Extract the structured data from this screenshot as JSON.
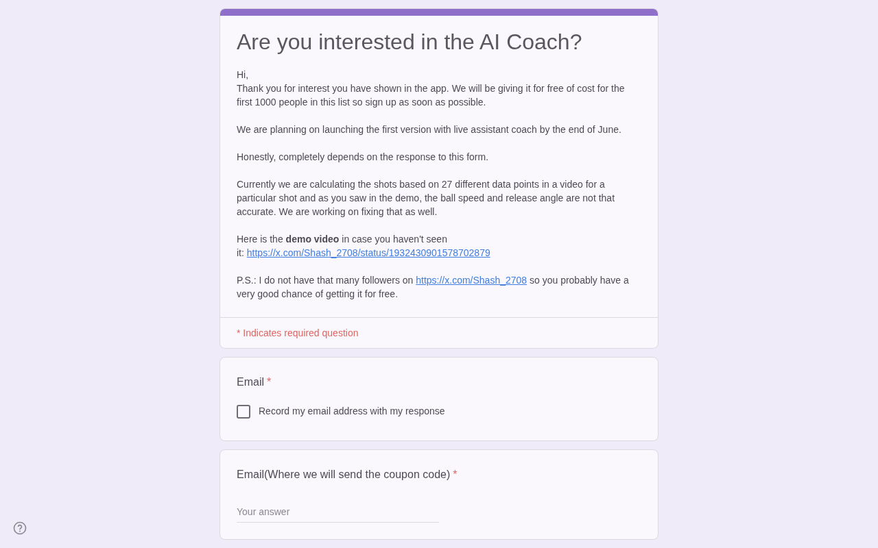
{
  "form": {
    "title": "Are you interested in the AI Coach?",
    "description": [
      {
        "parts": [
          {
            "kind": "text",
            "text": "Hi,"
          },
          {
            "kind": "break"
          },
          {
            "kind": "text",
            "text": "Thank you for interest you have shown in the app. We will be giving it for free of cost for the first 1000 people in this list so sign up as soon as possible."
          }
        ]
      },
      {
        "parts": [
          {
            "kind": "text",
            "text": "We are planning on launching the first version with live assistant coach by the end of June."
          }
        ]
      },
      {
        "parts": [
          {
            "kind": "text",
            "text": "Honestly, completely depends on the response to this form."
          }
        ]
      },
      {
        "parts": [
          {
            "kind": "text",
            "text": "Currently we are calculating the shots based on 27 different data points in a video for a particular shot and as you saw in the demo, the ball speed and release angle are not that accurate. We are working on fixing that as well."
          }
        ]
      },
      {
        "parts": [
          {
            "kind": "text",
            "text": "Here is the **demo video** in case you haven't seen"
          },
          {
            "kind": "break"
          },
          {
            "kind": "text",
            "text": "it: "
          },
          {
            "kind": "link",
            "text": "https://x.com/Shash_2708/status/1932430901578702879"
          }
        ]
      },
      {
        "parts": [
          {
            "kind": "text",
            "text": "P.S.: I do not have that many followers on "
          },
          {
            "kind": "link",
            "text": "https://x.com/Shash_2708"
          },
          {
            "kind": "text",
            "text": " so you probably have a very good chance of getting it for free."
          }
        ]
      }
    ],
    "required_note": "* Indicates required question"
  },
  "questions": [
    {
      "kind": "checkbox",
      "title": "Email",
      "required": true,
      "required_mark": "*",
      "option": {
        "label": "Record my email address with my response",
        "checked": false
      }
    },
    {
      "kind": "text",
      "title": "Email(Where we will send the coupon code)",
      "required": true,
      "required_mark": "*",
      "placeholder": "Your answer"
    }
  ]
}
